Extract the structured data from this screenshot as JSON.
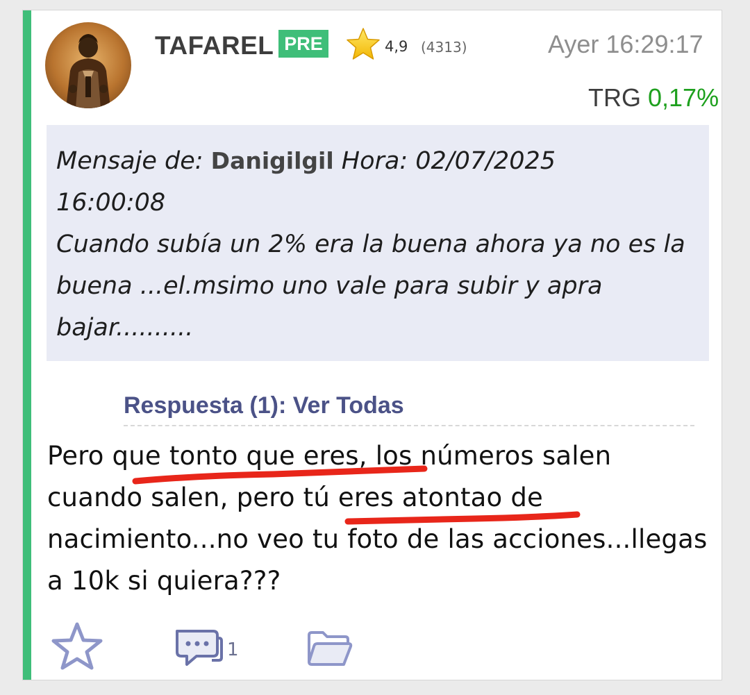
{
  "post": {
    "username": "TAFAREL",
    "badge": "PRE",
    "rating": "4,9",
    "rating_count": "(4313)",
    "timestamp": "Ayer 16:29:17",
    "ticker": "TRG",
    "ticker_change": "0,17%",
    "quote": {
      "prefix": "Mensaje de:",
      "author": "Danigilgil",
      "time_label": "Hora: 02/07/2025",
      "time_value": "16:00:08",
      "text": "Cuando subía un 2% era la buena ahora ya no es la buena ...el.msimo uno vale para subir y apra bajar.........."
    },
    "reply_link": "Respuesta (1): Ver Todas",
    "body": "Pero que tonto que eres, los números salen cuando salen, pero tú eres atontao de nacimiento...no veo tu foto de las acciones...llegas a 10k si quiera???",
    "actions": {
      "favorite_icon": "star-outline-icon",
      "comment_icon": "comment-bubble-icon",
      "comment_count": "1",
      "folder_icon": "folder-open-icon"
    },
    "colors": {
      "accent": "#3fbe79",
      "positive": "#1ea01e",
      "link": "#4b5287",
      "quote_bg": "#e9ebf5",
      "annotation": "#e8261a"
    }
  }
}
